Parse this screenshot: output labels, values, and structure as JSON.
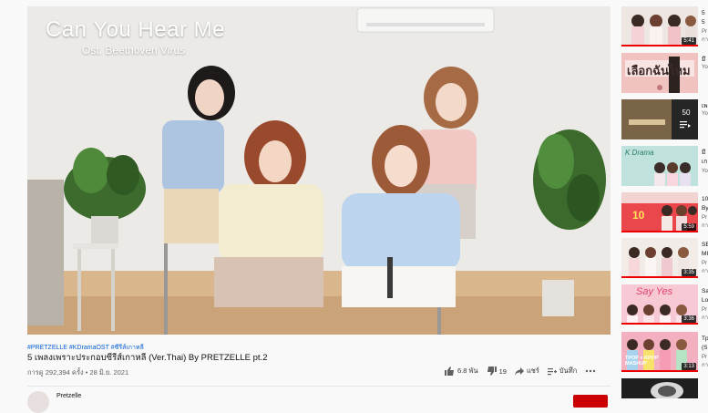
{
  "player": {
    "overlay_title": "Can You Hear Me",
    "overlay_subtitle": "Ost. Beethoven Virus"
  },
  "video": {
    "hashtags": "#PRETZELLE #KDramaOST #ซีรีส์เกาหลี",
    "title": "5 เพลงเพราะประกอบซีรีส์เกาหลี (Ver.Thai) By PRETZELLE pt.2",
    "meta": "การดู 292,394 ครั้ง • 28 มิ.ย. 2021"
  },
  "actions": {
    "like": "6.8 พัน",
    "dislike": "19",
    "share": "แชร์",
    "save": "บันทึก"
  },
  "channel": {
    "name": "Pretzelle"
  },
  "sidebar": {
    "items": [
      {
        "line1": "5",
        "line2": "5",
        "meta1": "Pr",
        "meta2": "กา",
        "duration": "5:41",
        "progress": 1.0
      },
      {
        "line1": "มึ",
        "line2": "",
        "meta1": "Yo",
        "meta2": "",
        "thumb_text": "เลือกฉันไหม",
        "duration": "",
        "progress": 0
      },
      {
        "line1": "เพ",
        "line2": "",
        "meta1": "Yo",
        "meta2": "",
        "thumb_count": "50",
        "duration": "",
        "progress": 0
      },
      {
        "line1": "มึ",
        "line2": "เก",
        "meta1": "Yo",
        "meta2": "",
        "thumb_text": "K Drama",
        "duration": "",
        "progress": 0
      },
      {
        "line1": "10",
        "line2": "By",
        "meta1": "Pr",
        "meta2": "กา",
        "thumb_text": "10",
        "duration": "5:59",
        "progress": 1.0
      },
      {
        "line1": "SE",
        "line2": "MI",
        "meta1": "Pr",
        "meta2": "กา",
        "duration": "3:35",
        "progress": 1.0
      },
      {
        "line1": "Sa",
        "line2": "Lo",
        "meta1": "Pr",
        "meta2": "กา",
        "thumb_text": "Say Yes",
        "duration": "3:36",
        "progress": 1.0
      },
      {
        "line1": "Tp",
        "line2": "(S",
        "meta1": "Pr",
        "meta2": "กา",
        "thumb_text": "TPOP x KPOP MASHUP",
        "duration": "3:13",
        "progress": 1.0
      },
      {
        "line1": "",
        "line2": "",
        "meta1": "",
        "meta2": "",
        "duration": "",
        "progress": 0
      }
    ]
  }
}
